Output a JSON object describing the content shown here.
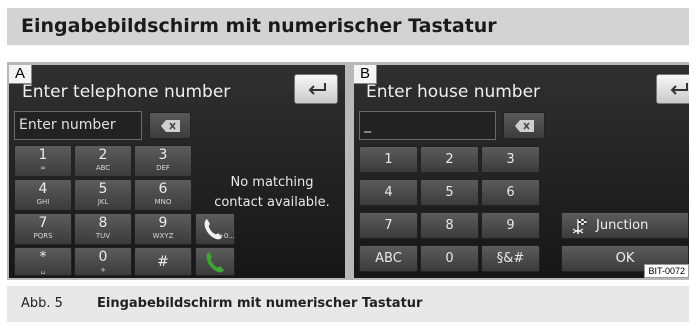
{
  "header": {
    "title": "Eingabebildschirm mit numerischer Tastatur"
  },
  "caption": {
    "prefix": "Abb. 5",
    "title": "Eingabebildschirm mit numerischer Tastatur"
  },
  "screen_a": {
    "label": "A",
    "title": "Enter telephone number",
    "input_placeholder": "Enter number",
    "keys": [
      {
        "num": "1",
        "sub": "∞"
      },
      {
        "num": "2",
        "sub": "ABC"
      },
      {
        "num": "3",
        "sub": "DEF"
      },
      {
        "num": "4",
        "sub": "GHI"
      },
      {
        "num": "5",
        "sub": "JKL"
      },
      {
        "num": "6",
        "sub": "MNO"
      },
      {
        "num": "7",
        "sub": "PQRS"
      },
      {
        "num": "8",
        "sub": "TUV"
      },
      {
        "num": "9",
        "sub": "WXYZ"
      },
      {
        "num": "*",
        "sub": "␣"
      },
      {
        "num": "0",
        "sub": "+"
      },
      {
        "num": "#",
        "sub": ""
      }
    ],
    "call_plus_label": "+0...",
    "message_line1": "No matching",
    "message_line2": "contact available."
  },
  "screen_b": {
    "label": "B",
    "title": "Enter house number",
    "input_value": "_",
    "keys": [
      "1",
      "2",
      "3",
      "4",
      "5",
      "6",
      "7",
      "8",
      "9",
      "ABC",
      "0",
      "§&#"
    ],
    "junction_label": "Junction",
    "ok_label": "OK",
    "figure_code": "BIT-0072"
  },
  "colors": {
    "call_green": "#3fa535",
    "header_bg": "#d3d3d3",
    "caption_bg": "#e8e8e8"
  }
}
